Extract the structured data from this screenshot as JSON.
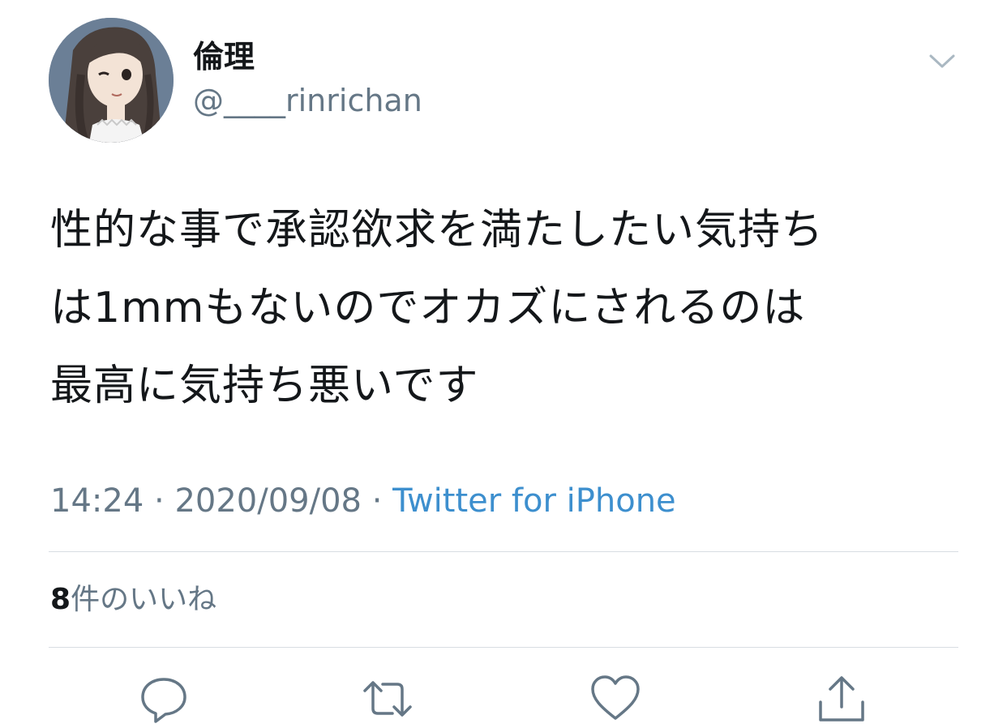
{
  "user": {
    "display_name": "倫理",
    "handle": "@____rinrichan",
    "avatar_icon": "avatar-illustration-icon"
  },
  "tweet": {
    "lines": [
      "性的な事で承認欲求を満たしたい気持ち",
      "は1mmもないのでオカズにされるのは",
      "最高に気持ち悪いです"
    ],
    "time": "14:24",
    "date": "2020/09/08",
    "separator": "·",
    "source": "Twitter for iPhone"
  },
  "stats": {
    "like_count": "8",
    "like_label": "件のいいね"
  },
  "actions": {
    "reply_icon": "reply-icon",
    "retweet_icon": "retweet-icon",
    "like_icon": "heart-icon",
    "share_icon": "share-icon"
  },
  "colors": {
    "text": "#14171a",
    "muted": "#657786",
    "link": "#3d8fce",
    "divider": "#d8dde2"
  }
}
